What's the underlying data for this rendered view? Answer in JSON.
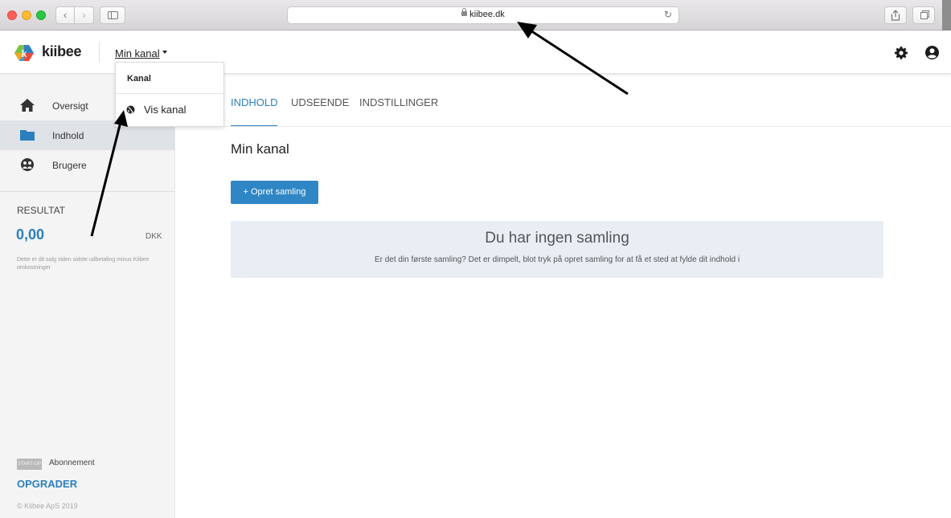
{
  "browser": {
    "url": "kiibee.dk",
    "icons": {
      "back": "chevron-left-icon",
      "forward": "chevron-right-icon",
      "sidebar": "sidebar-icon",
      "lock": "lock-icon",
      "reload": "reload-icon",
      "share": "share-icon",
      "tabs": "tabs-icon"
    }
  },
  "header": {
    "logo_text": "kiibee",
    "channel_menu_label": "Min kanal",
    "icons": {
      "settings": "gear-icon",
      "account": "user-circle-icon"
    }
  },
  "dropdown": {
    "header": "Kanal",
    "items": [
      {
        "label": "Vis kanal",
        "icon": "globe-icon"
      }
    ]
  },
  "sidebar": {
    "items": [
      {
        "label": "Oversigt",
        "icon": "home-icon",
        "active": false
      },
      {
        "label": "Indhold",
        "icon": "folder-icon",
        "active": true
      },
      {
        "label": "Brugere",
        "icon": "users-icon",
        "active": false
      }
    ],
    "result": {
      "title": "RESULTAT",
      "amount": "0,00",
      "currency": "DKK",
      "description": "Dette er dit salg siden sidste udbetaling minus Kiibee omkostninger"
    },
    "plan_badge": "START-UP",
    "plan_label": "Abonnement",
    "upgrade_label": "OPGRADER",
    "copyright": "© Kiibee ApS 2019"
  },
  "main": {
    "tabs": [
      {
        "label": "INDHOLD",
        "active": true
      },
      {
        "label": "UDSEENDE",
        "active": false
      },
      {
        "label": "INDSTILLINGER",
        "active": false
      }
    ],
    "title": "Min kanal",
    "create_button": "+ Opret samling",
    "empty_state": {
      "title": "Du har ingen samling",
      "description": "Er det din første samling? Det er dimpelt, blot tryk på opret samling for at få et sted at fylde dit indhold i"
    }
  },
  "colors": {
    "accent": "#2a7fbe",
    "button": "#2f86c5",
    "empty_panel": "#e8eef4",
    "sidebar_bg": "#f4f4f4",
    "sidebar_active": "#dfe3e8"
  }
}
